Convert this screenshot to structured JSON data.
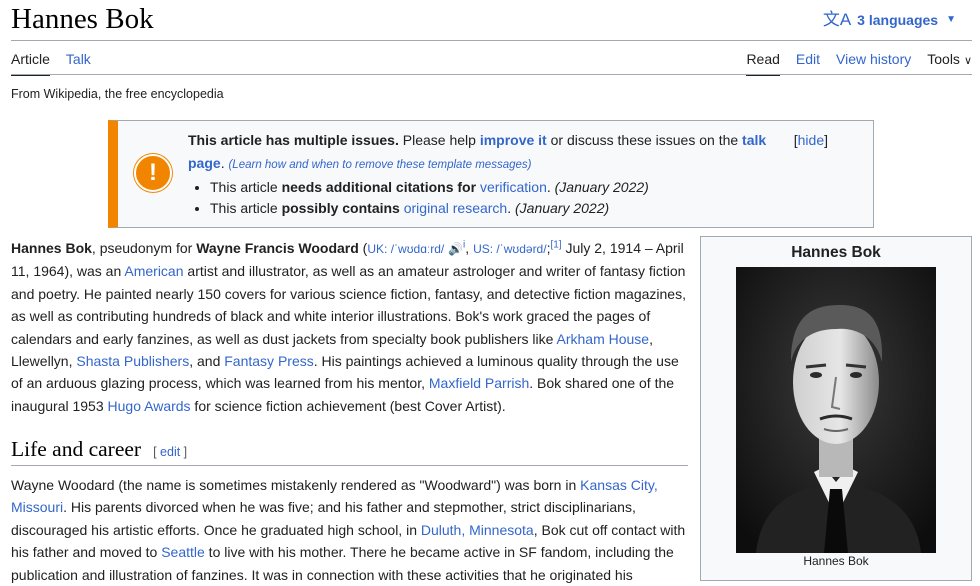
{
  "header": {
    "title": "Hannes Bok",
    "languages": "3 languages"
  },
  "tabs": {
    "article": "Article",
    "talk": "Talk",
    "read": "Read",
    "edit": "Edit",
    "view_history": "View history",
    "tools": "Tools"
  },
  "tagline": "From Wikipedia, the free encyclopedia",
  "issues": {
    "lead_bold": "This article has multiple issues.",
    "lead_text": " Please help ",
    "improve_link": "improve it",
    "lead_text2": " or discuss these issues on the ",
    "talk_link": "talk page",
    "period": ". ",
    "learn": "(Learn how and when to remove these template messages)",
    "hide": "hide",
    "items": [
      {
        "pre": "This article ",
        "bold": "needs additional citations for ",
        "link": "verification",
        "post": ". ",
        "date": "(January 2022)"
      },
      {
        "pre": "This article ",
        "bold": "possibly contains ",
        "link": "original research",
        "post": ". ",
        "date": "(January 2022)"
      }
    ]
  },
  "intro": {
    "name": "Hannes Bok",
    "t1": ", pseudonym for ",
    "real_name": "Wayne Francis Woodard",
    "t2": " (",
    "uk": "UK: /ˈwʊdɑːrd/",
    "i": "i",
    "us": "US: /ˈwʊdərd/",
    "ref": "[1]",
    "t3": " July 2, 1914 – April 11, 1964), was an ",
    "american": "American",
    "t4": " artist and illustrator, as well as an amateur astrologer and writer of fantasy fiction and poetry. He painted nearly 150 covers for various science fiction, fantasy, and detective fiction magazines, as well as contributing hundreds of black and white interior illustrations. Bok's work graced the pages of calendars and early fanzines, as well as dust jackets from specialty book publishers like ",
    "arkham": "Arkham House",
    "t5": ", Llewellyn, ",
    "shasta": "Shasta Publishers",
    "t6": ", and ",
    "fantasy": "Fantasy Press",
    "t7": ". His paintings achieved a luminous quality through the use of an arduous glazing process, which was learned from his mentor, ",
    "parrish": "Maxfield Parrish",
    "t8": ". Bok shared one of the inaugural 1953 ",
    "hugo": "Hugo Awards",
    "t9": " for science fiction achievement (best Cover Artist)."
  },
  "section": {
    "title": "Life and career",
    "edit": "edit"
  },
  "para2": {
    "t1": "Wayne Woodard (the name is sometimes mistakenly rendered as \"Woodward\") was born in ",
    "kansas": "Kansas City, Missouri",
    "t2": ". His parents divorced when he was five; and his father and stepmother, strict disciplinarians, discouraged his artistic efforts. Once he graduated high school, in ",
    "duluth": "Duluth, Minnesota",
    "t3": ", Bok cut off contact with his father and moved to ",
    "seattle": "Seattle",
    "t4": " to live with his mother. There he became active in SF fandom, including the publication and illustration of fanzines. It was in connection with these activities that he originated his"
  },
  "infobox": {
    "title": "Hannes Bok",
    "caption": "Hannes Bok"
  },
  "colors": {
    "link": "#3366cc",
    "warning": "#f28500"
  }
}
